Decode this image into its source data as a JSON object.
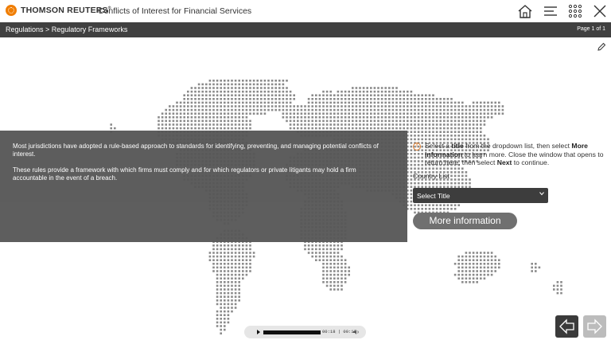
{
  "header": {
    "brand": "THOMSON REUTERS",
    "brand_mark": "®",
    "course_title": "Conflicts of Interest for Financial Services",
    "icons": [
      "home-icon",
      "menu-icon",
      "grid-icon",
      "close-icon"
    ]
  },
  "breadcrumb": {
    "path": "Regulations > Regulatory Frameworks",
    "page": "Page 1 of 1"
  },
  "intro": {
    "paragraph1": "Most jurisdictions have adopted a rule-based approach to standards for identifying, preventing, and managing potential conflicts of interest.",
    "paragraph2": "These rules provide a framework with which firms must comply and for which regulators or private litigants may hold a firm accountable in the event of a breach."
  },
  "instructions": {
    "t1": "Select a ",
    "b1": "title",
    "t2": " from the dropdown list, then select ",
    "b2": "More information",
    "t3": " to learn more. Close the window that opens to return here, then select ",
    "b3": "Next",
    "t4": " to continue."
  },
  "country_list": {
    "label": "Country List",
    "selected": "Select Title"
  },
  "more_info_button": "More information",
  "media_player": {
    "time": "00:18 | 00:18"
  },
  "colors": {
    "crumb_bar": "#404040",
    "panel": "#575757",
    "accent": "#f07d00",
    "button": "#707070"
  }
}
